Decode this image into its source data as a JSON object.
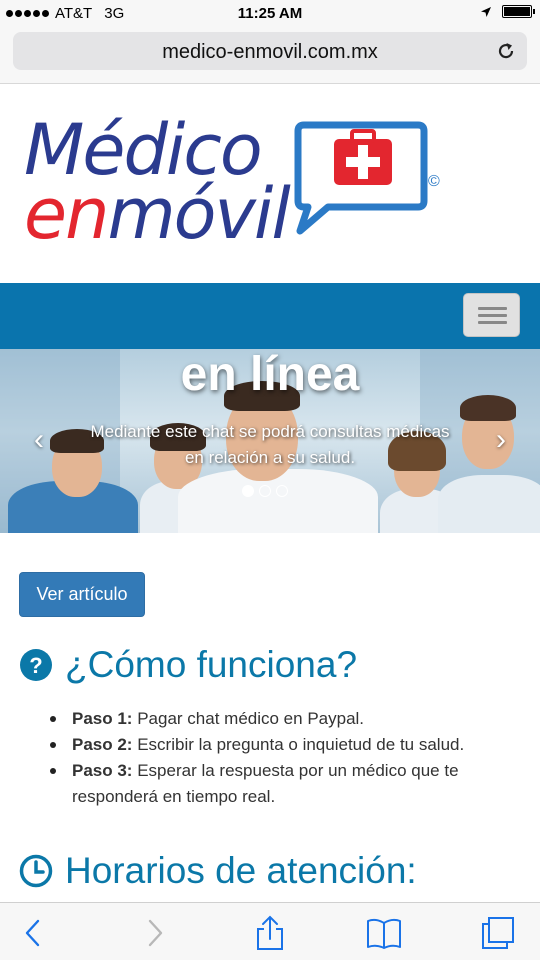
{
  "status_bar": {
    "carrier": "AT&T",
    "network": "3G",
    "time": "11:25 AM"
  },
  "browser": {
    "url": "medico-enmovil.com.mx"
  },
  "logo": {
    "line1": "Médico",
    "line2_en": "en",
    "line2_movil": "móvil",
    "copyright": "©"
  },
  "carousel": {
    "title": "en línea",
    "caption": "Mediante este chat se podrá consultas médicas en relación a su salud.",
    "slide_count": 3,
    "active_slide": 1
  },
  "main": {
    "article_button": "Ver artículo",
    "how_title": "¿Cómo funciona?",
    "steps": [
      {
        "label": "Paso 1:",
        "text": "Pagar chat médico en Paypal."
      },
      {
        "label": "Paso 2:",
        "text": "Escribir la pregunta o inquietud de tu salud."
      },
      {
        "label": "Paso 3:",
        "text": "Esperar la respuesta por un médico que te responderá en tiempo real."
      }
    ],
    "hours_title": "Horarios de atención:"
  },
  "colors": {
    "brand_blue": "#0b78a8",
    "nav_blue": "#0a74ad",
    "logo_navy": "#2b3b8f",
    "logo_red": "#e3262f",
    "button_blue": "#337ab7",
    "ios_blue": "#1a73e8"
  },
  "icons": {
    "question": "question-circle-icon",
    "clock": "clock-icon",
    "back": "back-icon",
    "forward": "forward-icon",
    "share": "share-icon",
    "bookmarks": "bookmarks-icon",
    "tabs": "tabs-icon",
    "reload": "reload-icon"
  }
}
